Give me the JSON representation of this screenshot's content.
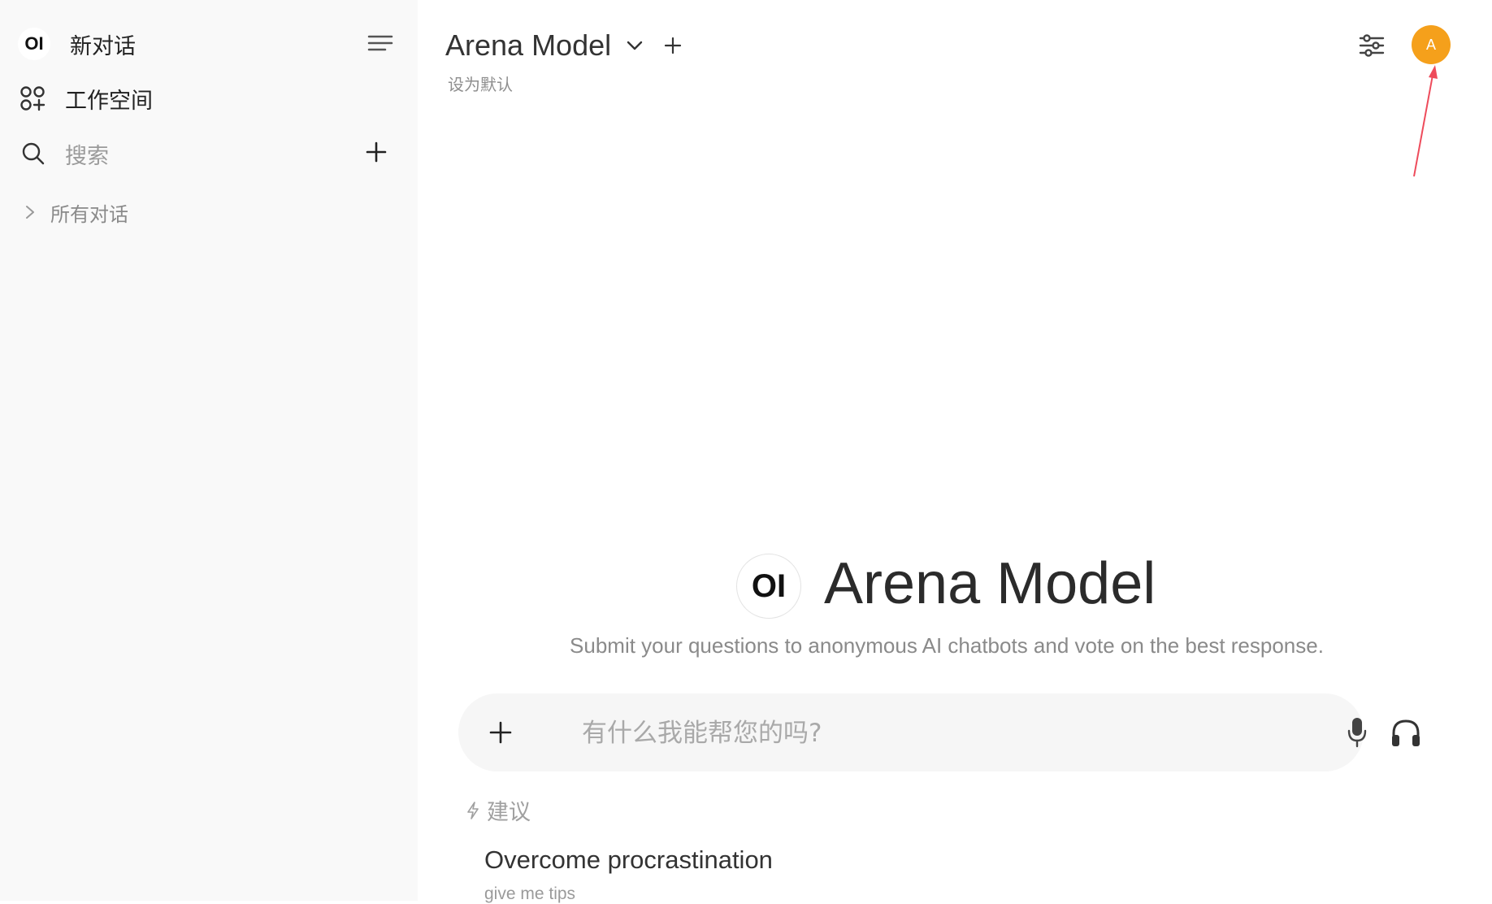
{
  "sidebar": {
    "logo_text": "OI",
    "new_chat_label": "新对话",
    "workspace_label": "工作空间",
    "search_placeholder": "搜索",
    "all_chats_label": "所有对话"
  },
  "header": {
    "model_name": "Arena Model",
    "set_default_label": "设为默认",
    "avatar_initial": "A",
    "avatar_color": "#f5a01b"
  },
  "hero": {
    "logo_text": "OI",
    "title": "Arena Model",
    "subtitle": "Submit your questions to anonymous AI chatbots and vote on the best response."
  },
  "chat": {
    "placeholder": "有什么我能帮您的吗?"
  },
  "suggestions": {
    "label": "建议",
    "items": [
      {
        "title": "Overcome procrastination",
        "subtitle": "give me tips"
      }
    ]
  },
  "annotation": {
    "arrow_color": "#ee4b5b"
  }
}
